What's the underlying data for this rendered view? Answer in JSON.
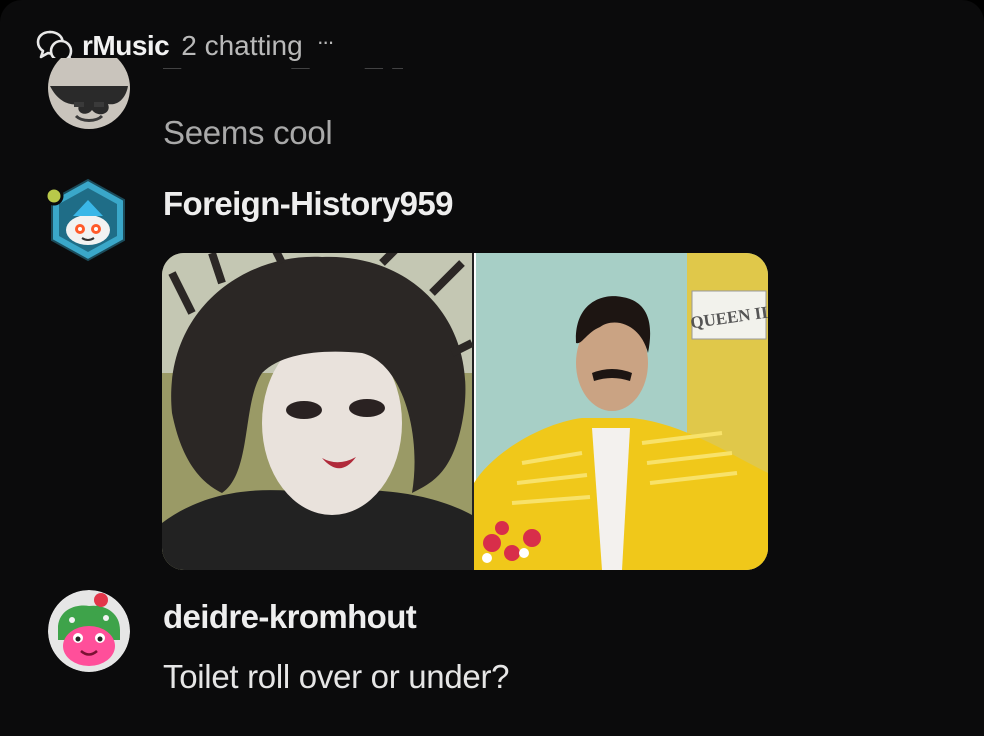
{
  "header": {
    "room_name": "rMusic",
    "chatting": "2 chatting",
    "more": "···"
  },
  "messages": [
    {
      "user": "",
      "text": "Seems cool",
      "avatar": "partially-hidden-avatar"
    },
    {
      "user": "Foreign-History959",
      "text": "",
      "avatar": "snoo-robot-avatar",
      "image": {
        "sign_text": "QUEEN II"
      }
    },
    {
      "user": "deidre-kromhout",
      "text": "Toilet roll over or under?",
      "avatar": "green-frog-avatar"
    }
  ],
  "colors": {
    "background": "#0b0b0c",
    "text_primary": "#eeeeee",
    "text_muted": "#a9a9a9",
    "accent_teal": "#3aa7c9",
    "online_dot": "#b9c94a"
  }
}
